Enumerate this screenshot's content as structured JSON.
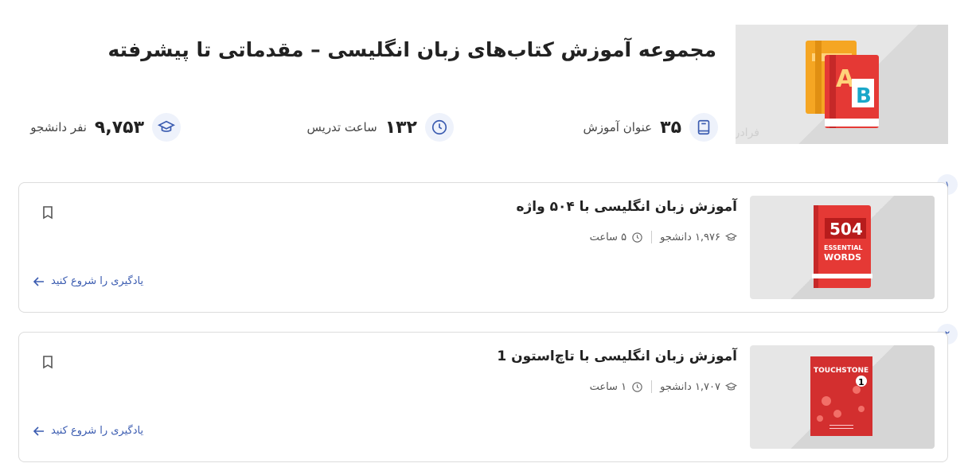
{
  "header": {
    "title": "مجموعه آموزش کتاب‌های زبان انگلیسی – مقدماتی تا پیشرفته",
    "image_watermark": "فرادرس"
  },
  "stats": {
    "topics": {
      "value": "۳۵",
      "label": "عنوان آموزش",
      "icon": "book-icon"
    },
    "hours": {
      "value": "۱۳۲",
      "label": "ساعت تدریس",
      "icon": "clock-icon"
    },
    "students": {
      "value": "۹,۷۵۳",
      "label": "نفر دانشجو",
      "icon": "graduation-cap-icon"
    }
  },
  "courses": [
    {
      "index": "۱",
      "title": "آموزش زبان انگلیسی با ۵۰۴ واژه",
      "students": "۱,۹۷۶ دانشجو",
      "duration": "۵ ساعت",
      "cta": "یادگیری را شروع کنید",
      "cover": {
        "line1": "504",
        "line2": "ESSENTIAL",
        "line3": "WORDS"
      }
    },
    {
      "index": "۲",
      "title": "آموزش زبان انگلیسی با تاچ‌استون 1",
      "students": "۱,۷۰۷ دانشجو",
      "duration": "۱ ساعت",
      "cta": "یادگیری را شروع کنید",
      "cover": {
        "line1": "TOUCHSTONE",
        "line2": "1"
      }
    }
  ],
  "colors": {
    "accent": "#3a5bb0",
    "book_red": "#e53935",
    "book_orange": "#f5a623"
  }
}
